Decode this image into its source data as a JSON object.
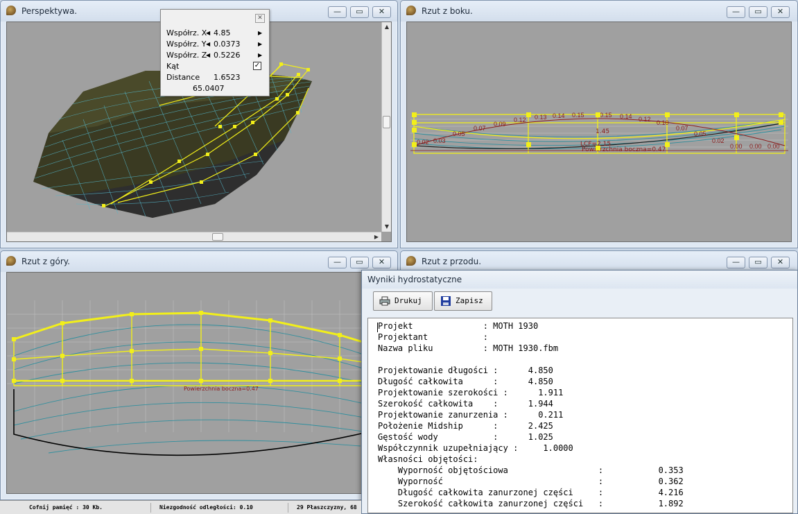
{
  "windows": {
    "perspective": {
      "title": "Perspektywa."
    },
    "side": {
      "title": "Rzut z boku."
    },
    "top": {
      "title": "Rzut z góry."
    },
    "front": {
      "title": "Rzut z przodu."
    }
  },
  "window_controls": {
    "minimize": "—",
    "restore": "▭",
    "close": "✕"
  },
  "coord_panel": {
    "x_label": "Współrz. X",
    "x_value": "4.85",
    "y_label": "Współrz. Y",
    "y_value": "0.0373",
    "z_label": "Współrz. Z",
    "z_value": "0.5226",
    "angle_label": "Kąt",
    "angle_checked": "✓",
    "distance_label": "Distance",
    "distance_value": "1.6523",
    "angle_value": "65.0407"
  },
  "side_view": {
    "labels": [
      "0.02",
      "0.03",
      "0.05",
      "0.07",
      "0.09",
      "0.12",
      "0.13",
      "0.14",
      "0.15",
      "0.15",
      "0.14",
      "0.12",
      "0.10",
      "0.07",
      "0.05",
      "0.02",
      "0.00",
      "0.00",
      "0.00"
    ],
    "lcf_label": "LCF=2.15",
    "midpoint_label": "1.45",
    "lateral_label": "Powierzchnia boczna=0.47"
  },
  "top_view": {
    "lateral_label": "Powierzchnia boczna=0.47"
  },
  "hydro": {
    "title": "Wyniki hydrostatyczne",
    "print_button": "Drukuj",
    "save_button": "Zapisz",
    "lines": [
      "Projekt              : MOTH 1930",
      "Projektant           :",
      "Nazwa pliku          : MOTH 1930.fbm",
      "",
      "Projektowanie długości :      4.850",
      "Długość całkowita      :      4.850",
      "Projektowanie szerokości :      1.911",
      "Szerokość całkowita    :      1.944",
      "Projektowanie zanurzenia :      0.211",
      "Położenie Midship      :      2.425",
      "Gęstość wody           :      1.025",
      "Współczynnik uzupełniający :     1.0000",
      "Własności objętości:",
      "    Wyporność objętościowa                  :           0.353",
      "    Wyporność                               :           0.362",
      "    Długość całkowita zanurzonej części     :           4.216",
      "    Szerokość całkowita zanurzonej części   :           1.892"
    ]
  },
  "statusbar": {
    "memory": "Cofnij pamięć : 30 Kb.",
    "tolerance": "Niezgodność odległości: 0.10",
    "surfaces": "29 Płaszczyzny, 68"
  }
}
